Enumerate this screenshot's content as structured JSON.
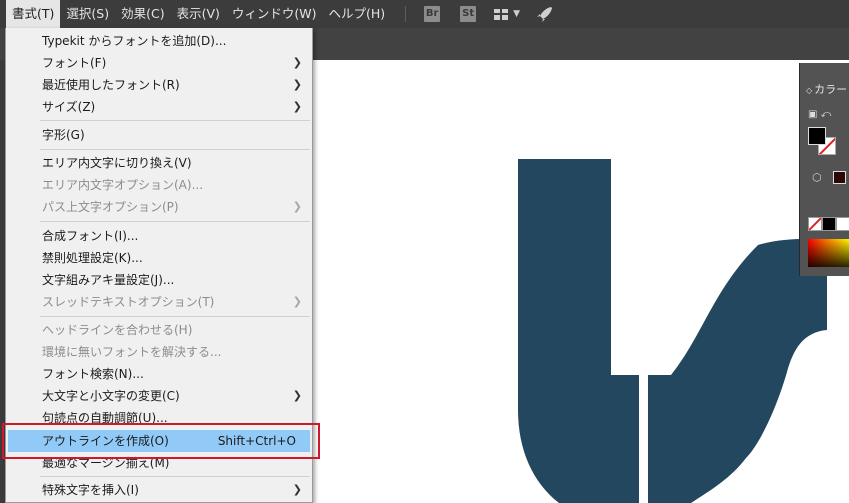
{
  "menubar": {
    "items": [
      "書式(T)",
      "選択(S)",
      "効果(C)",
      "表示(V)",
      "ウィンドウ(W)",
      "ヘルプ(H)"
    ],
    "active_index": 0,
    "bridge_badge": "Br",
    "stock_badge": "St",
    "workspace_icon": "workspace-grid-icon",
    "rocket_icon": "rocket-icon"
  },
  "menu": {
    "items": [
      {
        "label": "Typekit からフォントを追加(D)...",
        "enabled": true
      },
      {
        "label": "フォント(F)",
        "enabled": true,
        "submenu": true
      },
      {
        "label": "最近使用したフォント(R)",
        "enabled": true,
        "submenu": true
      },
      {
        "label": "サイズ(Z)",
        "enabled": true,
        "submenu": true
      },
      {
        "label": "字形(G)",
        "enabled": true
      },
      {
        "label": "エリア内文字に切り換え(V)",
        "enabled": true
      },
      {
        "label": "エリア内文字オプション(A)...",
        "enabled": false
      },
      {
        "label": "パス上文字オプション(P)",
        "enabled": false,
        "submenu": true
      },
      {
        "label": "合成フォント(I)...",
        "enabled": true
      },
      {
        "label": "禁則処理設定(K)...",
        "enabled": true
      },
      {
        "label": "文字組みアキ量設定(J)...",
        "enabled": true
      },
      {
        "label": "スレッドテキストオプション(T)",
        "enabled": false,
        "submenu": true
      },
      {
        "label": "ヘッドラインを合わせる(H)",
        "enabled": false
      },
      {
        "label": "環境に無いフォントを解決する...",
        "enabled": false
      },
      {
        "label": "フォント検索(N)...",
        "enabled": true
      },
      {
        "label": "大文字と小文字の変更(C)",
        "enabled": true,
        "submenu": true
      },
      {
        "label": "句読点の自動調節(U)...",
        "enabled": true
      },
      {
        "label": "アウトラインを作成(O)",
        "enabled": true,
        "highlighted": true,
        "shortcut": "Shift+Ctrl+O"
      },
      {
        "label": "最適なマージン揃え(M)",
        "enabled": true
      },
      {
        "label": "特殊文字を挿入(I)",
        "enabled": true,
        "submenu": true
      }
    ]
  },
  "color_panel": {
    "title": "カラー",
    "fill_color": "#000000",
    "stroke_color": "none",
    "selected_swatch": "#2b0808"
  },
  "artwork": {
    "shape_color": "#22475e"
  }
}
